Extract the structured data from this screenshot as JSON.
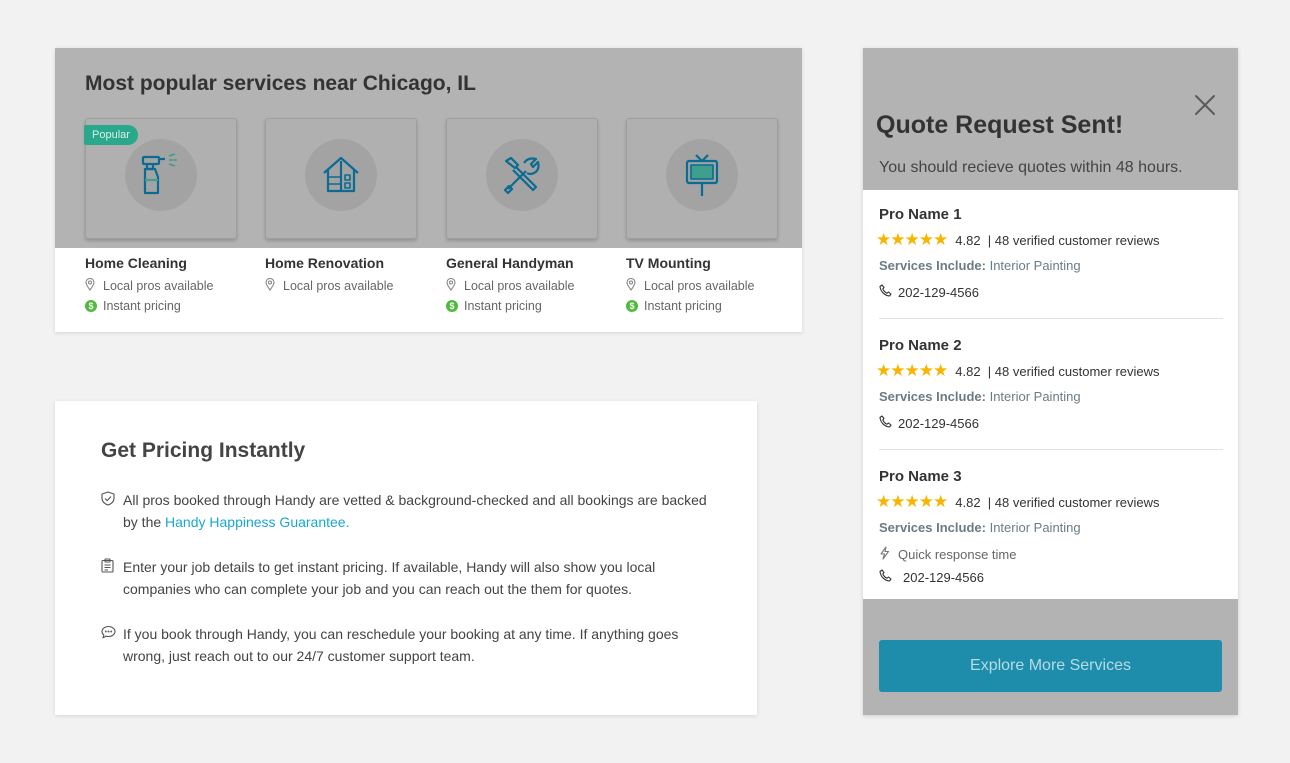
{
  "popular": {
    "heading": "Most popular services near Chicago, IL",
    "badge": "Popular",
    "services": [
      {
        "name": "Home Cleaning",
        "local": "Local pros available",
        "pricing": "Instant pricing",
        "icon": "spray-bottle-icon"
      },
      {
        "name": "Home Renovation",
        "local": "Local pros available",
        "icon": "house-icon"
      },
      {
        "name": "General Handyman",
        "local": "Local pros available",
        "pricing": "Instant pricing",
        "icon": "tools-icon"
      },
      {
        "name": "TV Mounting",
        "local": "Local pros available",
        "pricing": "Instant pricing",
        "icon": "tv-icon"
      }
    ]
  },
  "pricing": {
    "title": "Get Pricing Instantly",
    "items": [
      {
        "icon": "shield-check-icon",
        "text": "All pros booked through Handy are vetted & background-checked and all bookings are backed by the ",
        "link": "Handy Happiness Guarantee."
      },
      {
        "icon": "clipboard-icon",
        "text": "Enter your job details to get instant pricing. If available, Handy will also show you local companies who can complete your job and you can reach out the them for quotes."
      },
      {
        "icon": "chat-bubble-icon",
        "text": "If you book through Handy, you can reschedule your booking at any time. If anything goes wrong, just reach out to our 24/7 customer support team."
      }
    ]
  },
  "quote": {
    "title": "Quote Request Sent!",
    "subtitle": "You should recieve quotes within 48 hours.",
    "services_label": "Services Include:",
    "pros": [
      {
        "name": "Pro Name 1",
        "rating": "4.82",
        "reviews": "| 48 verified customer reviews",
        "services": "Interior Painting",
        "phone": "202-129-4566"
      },
      {
        "name": "Pro Name 2",
        "rating": "4.82",
        "reviews": "| 48 verified customer reviews",
        "services": "Interior Painting",
        "phone": "202-129-4566"
      },
      {
        "name": "Pro Name 3",
        "rating": "4.82",
        "reviews": "| 48 verified customer reviews",
        "services": "Interior Painting",
        "quick": "Quick response time",
        "phone": "202-129-4566"
      }
    ],
    "button": "Explore More Services"
  },
  "colors": {
    "accent": "#1aa8cf",
    "button": "#1e8dab",
    "star": "#f7b500",
    "badge": "#2aa88b",
    "dollar": "#4fba3b"
  }
}
